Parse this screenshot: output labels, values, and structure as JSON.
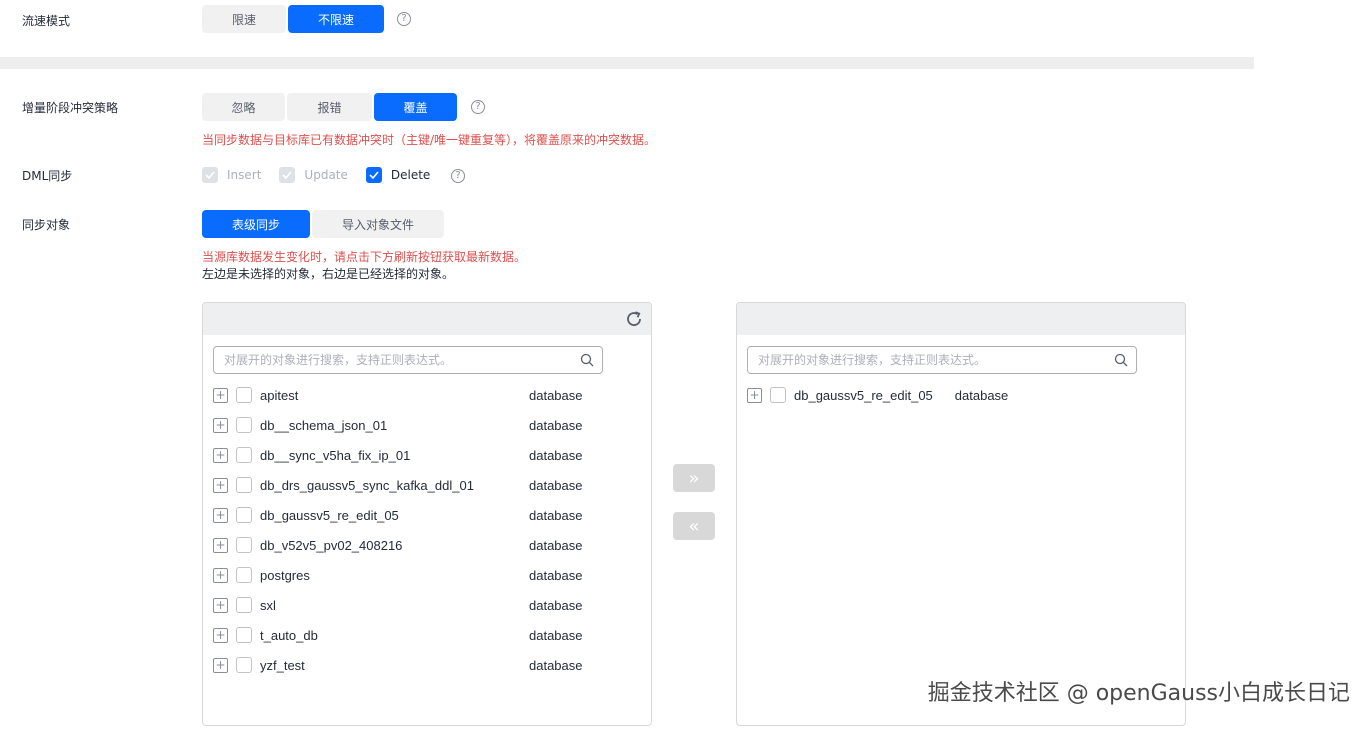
{
  "flow_mode": {
    "label": "流速模式",
    "options": [
      "限速",
      "不限速"
    ],
    "selected": "不限速"
  },
  "conflict_strategy": {
    "label": "增量阶段冲突策略",
    "options": [
      "忽略",
      "报错",
      "覆盖"
    ],
    "selected": "覆盖",
    "hint": "当同步数据与目标库已有数据冲突时（主键/唯一键重复等），将覆盖原来的冲突数据。"
  },
  "dml_sync": {
    "label": "DML同步",
    "items": [
      {
        "label": "Insert",
        "checked": true,
        "disabled": true
      },
      {
        "label": "Update",
        "checked": true,
        "disabled": true
      },
      {
        "label": "Delete",
        "checked": true,
        "disabled": false
      }
    ]
  },
  "sync_object": {
    "label": "同步对象",
    "tabs": [
      "表级同步",
      "导入对象文件"
    ],
    "selected": "表级同步",
    "warning": "当源库数据发生变化时，请点击下方刷新按钮获取最新数据。",
    "note": "左边是未选择的对象，右边是已经选择的对象。"
  },
  "left_panel": {
    "search_placeholder": "对展开的对象进行搜索，支持正则表达式。",
    "items": [
      {
        "name": "apitest",
        "type": "database"
      },
      {
        "name": "db__schema_json_01",
        "type": "database"
      },
      {
        "name": "db__sync_v5ha_fix_ip_01",
        "type": "database"
      },
      {
        "name": "db_drs_gaussv5_sync_kafka_ddl_01",
        "type": "database"
      },
      {
        "name": "db_gaussv5_re_edit_05",
        "type": "database"
      },
      {
        "name": "db_v52v5_pv02_408216",
        "type": "database"
      },
      {
        "name": "postgres",
        "type": "database"
      },
      {
        "name": "sxl",
        "type": "database"
      },
      {
        "name": "t_auto_db",
        "type": "database"
      },
      {
        "name": "yzf_test",
        "type": "database"
      }
    ]
  },
  "right_panel": {
    "search_placeholder": "对展开的对象进行搜索，支持正则表达式。",
    "items": [
      {
        "name": "db_gaussv5_re_edit_05",
        "type": "database"
      }
    ]
  },
  "move_buttons": {
    "add": "»",
    "remove": "«"
  },
  "watermark": "掘金技术社区 @ openGauss小白成长日记",
  "colors": {
    "accent": "#0a6cff",
    "warning": "#de504e"
  },
  "icons": {
    "help": "help-icon",
    "refresh": "refresh-icon",
    "search": "search-icon",
    "expand": "plus-icon"
  }
}
